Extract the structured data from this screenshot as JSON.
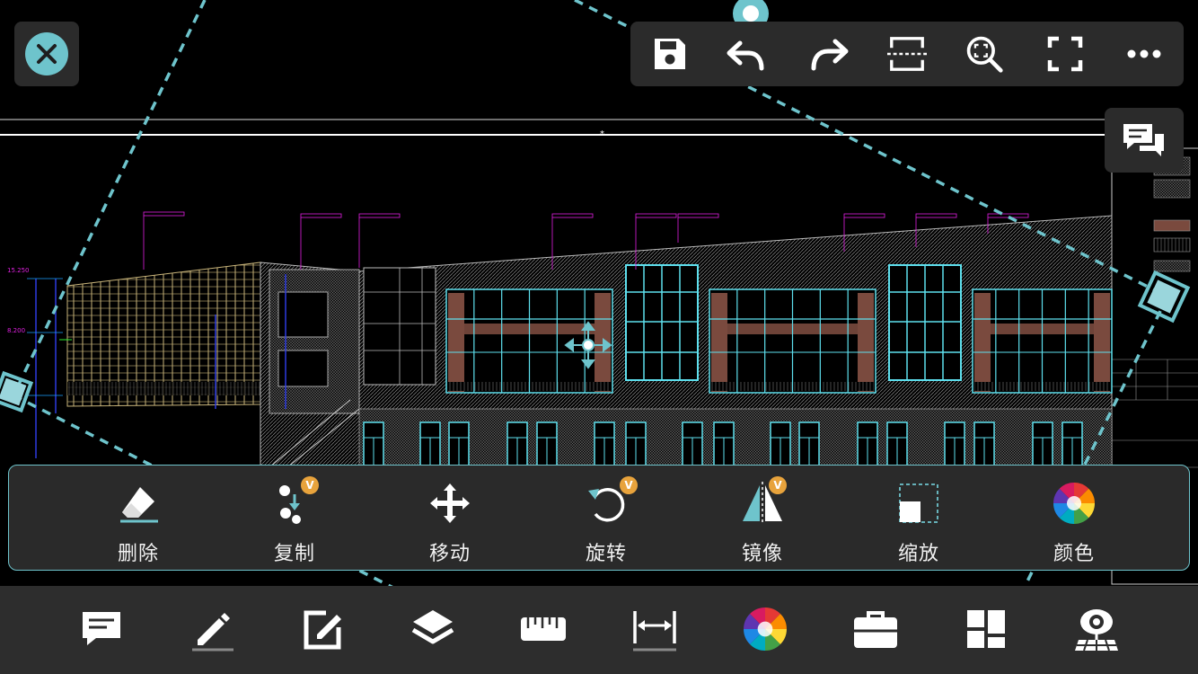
{
  "toolbar": {
    "close": "close-icon",
    "buttons": [
      {
        "name": "save",
        "icon": "save-icon"
      },
      {
        "name": "undo",
        "icon": "undo-icon"
      },
      {
        "name": "redo",
        "icon": "redo-icon"
      },
      {
        "name": "section",
        "icon": "section-icon"
      },
      {
        "name": "zoom-extent",
        "icon": "zoom-extent-icon"
      },
      {
        "name": "fullscreen",
        "icon": "fullscreen-icon"
      },
      {
        "name": "more",
        "icon": "more-icon"
      }
    ]
  },
  "comment_button": {
    "icon": "comments-icon"
  },
  "edit_panel": {
    "items": [
      {
        "label": "删除",
        "icon": "eraser-icon",
        "badge": ""
      },
      {
        "label": "复制",
        "icon": "copy-icon",
        "badge": "V"
      },
      {
        "label": "移动",
        "icon": "move-icon",
        "badge": ""
      },
      {
        "label": "旋转",
        "icon": "rotate-icon",
        "badge": "V"
      },
      {
        "label": "镜像",
        "icon": "mirror-icon",
        "badge": "V"
      },
      {
        "label": "缩放",
        "icon": "scale-icon",
        "badge": ""
      },
      {
        "label": "颜色",
        "icon": "color-wheel-icon",
        "badge": ""
      }
    ]
  },
  "bottom_bar": {
    "items": [
      {
        "name": "annotation",
        "icon": "comment-icon"
      },
      {
        "name": "pen",
        "icon": "pencil-icon"
      },
      {
        "name": "edit",
        "icon": "edit-icon"
      },
      {
        "name": "layers",
        "icon": "layers-icon"
      },
      {
        "name": "measure",
        "icon": "ruler-icon"
      },
      {
        "name": "dimension",
        "icon": "dimension-icon"
      },
      {
        "name": "color",
        "icon": "color-wheel-icon"
      },
      {
        "name": "toolbox",
        "icon": "toolbox-icon"
      },
      {
        "name": "grid",
        "icon": "grid-icon"
      },
      {
        "name": "view-3d",
        "icon": "view-3d-icon"
      }
    ]
  },
  "colors": {
    "accent": "#6ec4cc",
    "panel": "#2b2b2b",
    "badge": "#e8a33c",
    "drawing_cyan": "#5ee0ee",
    "drawing_magenta": "#e020e0",
    "drawing_tan": "#c8b47a",
    "drawing_brick": "#7a4a3e"
  }
}
